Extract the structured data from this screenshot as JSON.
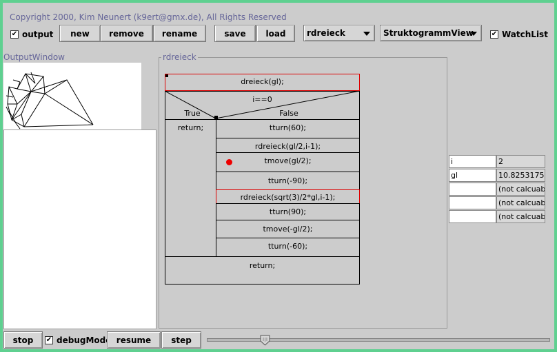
{
  "header": {
    "copyright": "Copyright 2000, Kim Neunert (k9ert@gmx.de), All Rights Reserved"
  },
  "toolbar": {
    "output_label": "output",
    "output_checked": "✔",
    "new_label": "new",
    "remove_label": "remove",
    "rename_label": "rename",
    "save_label": "save",
    "load_label": "load",
    "procedure_select": "rdreieck",
    "view_select": "StruktogrammView",
    "watchlist_label": "WatchList",
    "watchlist_checked": "✔"
  },
  "output_window": {
    "title": "OutputWindow"
  },
  "struktogramm": {
    "title": "rdreieck",
    "header": "dreieck(gl);",
    "condition": "i==0",
    "true_label": "True",
    "false_label": "False",
    "true_branch": "return;",
    "false_branch": [
      "tturn(60);",
      "rdreieck(gl/2,i-1);",
      "tmove(gl/2);",
      "tturn(-90);",
      "rdreieck(sqrt(3)/2*gl,i-1);",
      "tturn(90);",
      "tmove(-gl/2);",
      "tturn(-60);"
    ],
    "footer": "return;"
  },
  "watchlist": [
    {
      "name": "i",
      "value": "2"
    },
    {
      "name": "gl",
      "value": "10.8253175"
    },
    {
      "name": "",
      "value": "(not calcuab"
    },
    {
      "name": "",
      "value": "(not calcuab"
    },
    {
      "name": "",
      "value": "(not calcuab"
    }
  ],
  "bottom_bar": {
    "stop_label": "stop",
    "debug_label": "debugMode",
    "debug_checked": "✔",
    "resume_label": "resume",
    "step_label": "step"
  },
  "slider": {
    "value_fraction": 0.16
  },
  "colors": {
    "window_frame": "#5fd090",
    "background": "#cccccc",
    "label_color": "#666699",
    "highlight_border": "#dd0000",
    "breakpoint": "#ee0000"
  }
}
